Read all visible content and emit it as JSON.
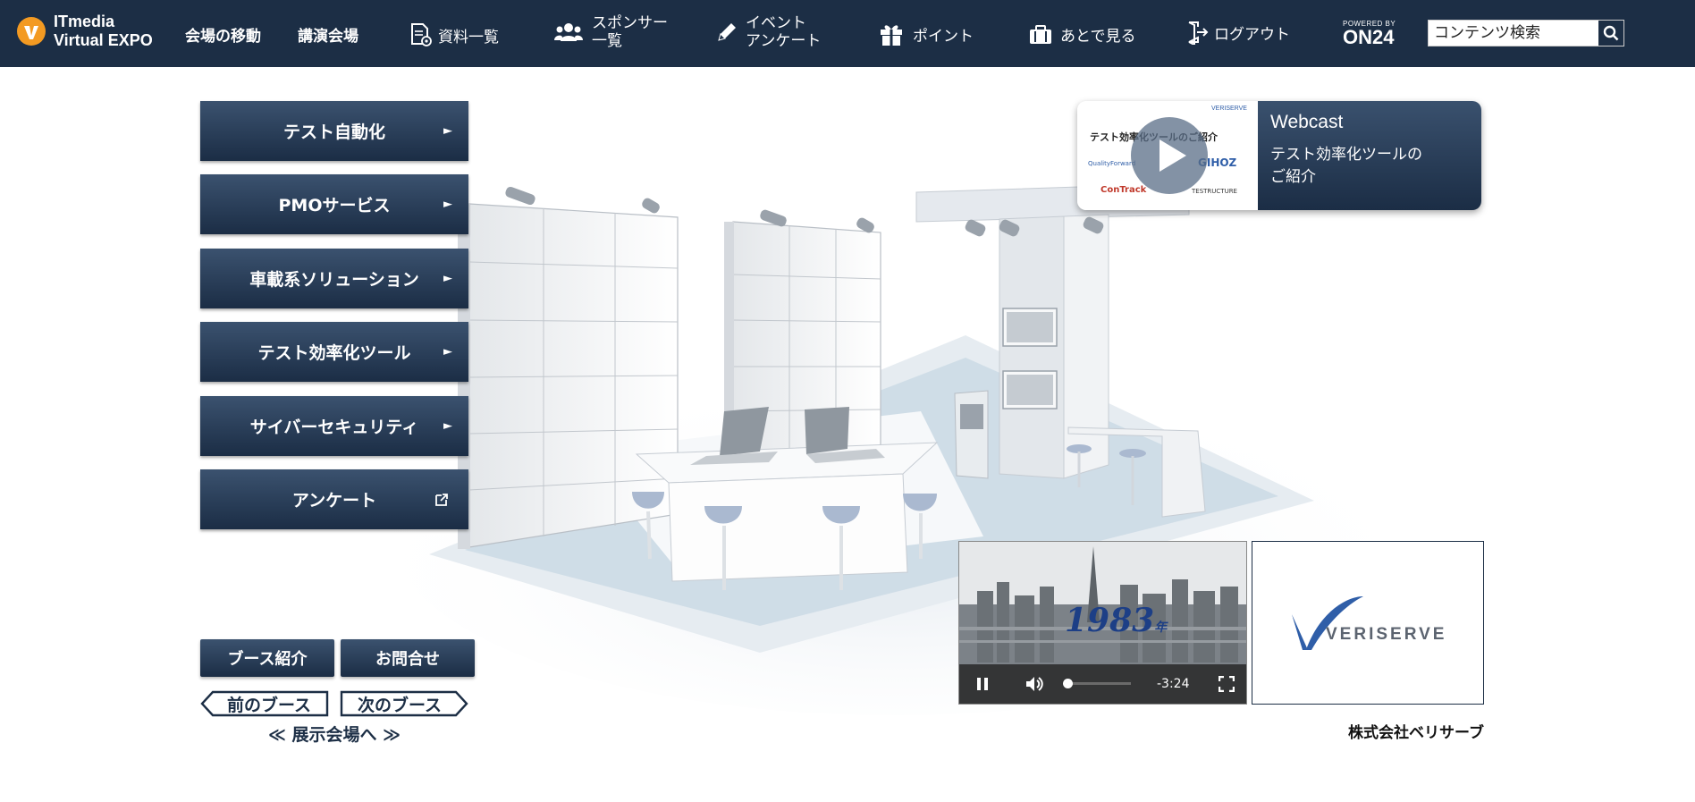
{
  "nav": {
    "brand_line1": "ITmedia",
    "brand_line2": "Virtual EXPO",
    "items": [
      {
        "label": "会場の移動"
      },
      {
        "label": "講演会場"
      },
      {
        "label": "資料一覧",
        "icon": "document-icon"
      },
      {
        "label1": "スポンサー",
        "label2": "一覧",
        "icon": "people-icon"
      },
      {
        "label1": "イベント",
        "label2": "アンケート",
        "icon": "pencil-icon"
      },
      {
        "label": "ポイント",
        "icon": "gift-icon"
      },
      {
        "label": "あとで見る",
        "icon": "briefcase-icon"
      },
      {
        "label": "ログアウト",
        "icon": "logout-icon"
      }
    ],
    "on24_small": "POWERED BY",
    "on24_big": "ON24",
    "search_placeholder": "コンテンツ検索"
  },
  "sidebar": {
    "buttons": [
      {
        "label": "テスト自動化",
        "arrow": "►"
      },
      {
        "label": "PMOサービス",
        "arrow": "►"
      },
      {
        "label": "車載系ソリューション",
        "arrow": "►"
      },
      {
        "label": "テスト効率化ツール",
        "arrow": "►"
      },
      {
        "label": "サイバーセキュリティ",
        "arrow": "►"
      },
      {
        "label": "アンケート",
        "arrow": "external-link-icon"
      }
    ],
    "booth_intro": "ブース紹介",
    "contact": "お問合せ",
    "prev_booth": "前のブース",
    "next_booth": "次のブース",
    "exhibit_hall": "≪ 展示会場へ ≫"
  },
  "webcast": {
    "title": "Webcast",
    "description": "テスト効率化ツールのご紹介",
    "thumb_heading": "テスト効率化ツールのご紹介",
    "thumb_brand": "VERISERVE",
    "thumb_products": [
      "QualityForward",
      "GIHOZ",
      "ConTrack",
      "TESTRUCTURE"
    ]
  },
  "video": {
    "year_text": "1983",
    "year_suffix": "年",
    "time_remaining": "-3:24",
    "progress_fraction": 0.02
  },
  "sponsor": {
    "logo_text": "VERISERVE",
    "company_name": "株式会社ベリサーブ"
  },
  "colors": {
    "nav_bg": "#1c2e45",
    "button_top": "#3b526f",
    "button_bottom": "#1b2d45",
    "brand_orange": "#f39a22",
    "veriserve_blue": "#2f5ea8"
  }
}
